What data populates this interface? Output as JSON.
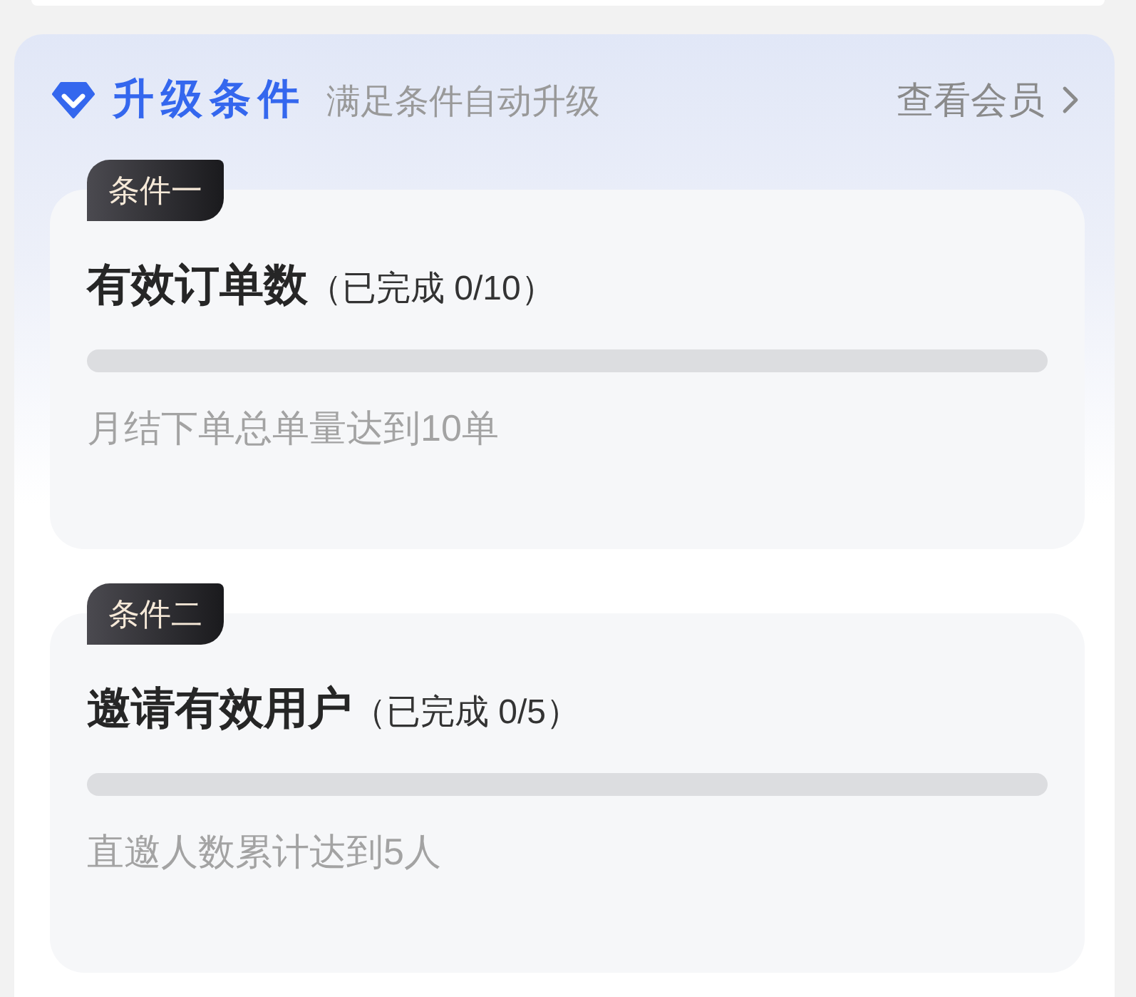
{
  "header": {
    "title": "升级条件",
    "subtitle": "满足条件自动升级",
    "link": "查看会员"
  },
  "conditions": [
    {
      "badge": "条件一",
      "title": "有效订单数",
      "progress_text": "（已完成 0/10）",
      "level": 0,
      "description": "月结下单总单量达到10单"
    },
    {
      "badge": "条件二",
      "title": "邀请有效用户",
      "progress_text": "（已完成 0/5）",
      "level": 0,
      "description": "直邀人数累计达到5人"
    }
  ]
}
